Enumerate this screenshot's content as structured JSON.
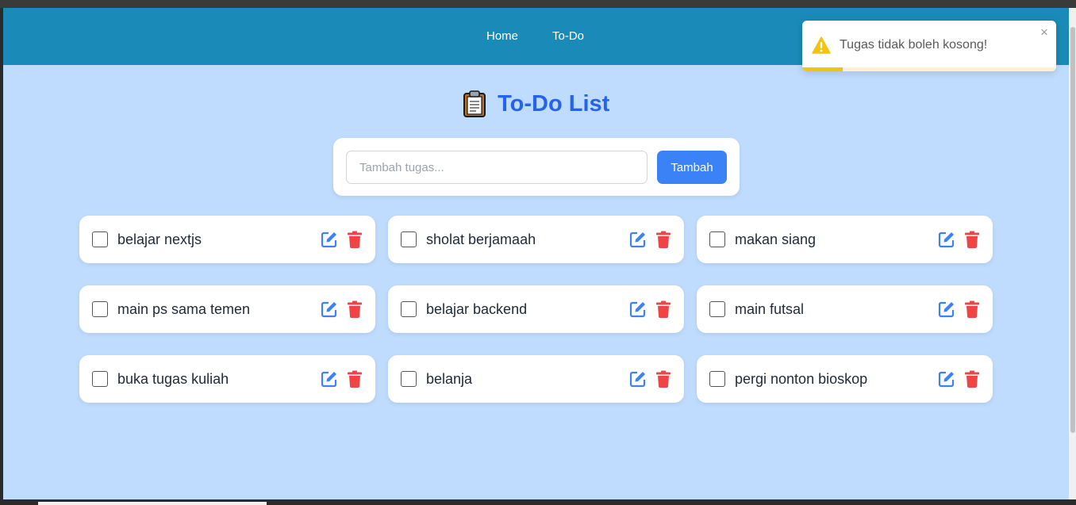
{
  "nav": {
    "home": "Home",
    "todo": "To-Do"
  },
  "page": {
    "title_icon": "clipboard-icon",
    "title": "To-Do List"
  },
  "input": {
    "placeholder": "Tambah tugas...",
    "value": "",
    "button_label": "Tambah"
  },
  "todos": [
    {
      "text": "belajar nextjs",
      "done": false
    },
    {
      "text": "sholat berjamaah",
      "done": false
    },
    {
      "text": "makan siang",
      "done": false
    },
    {
      "text": "main ps sama temen",
      "done": false
    },
    {
      "text": "belajar backend",
      "done": false
    },
    {
      "text": "main futsal",
      "done": false
    },
    {
      "text": "buka tugas kuliah",
      "done": false
    },
    {
      "text": "belanja",
      "done": false
    },
    {
      "text": "pergi nonton bioskop",
      "done": false
    }
  ],
  "toast": {
    "icon": "warning-icon",
    "message": "Tugas tidak boleh kosong!",
    "close": "×",
    "progress": 0.16
  },
  "colors": {
    "navbar": "#1a8bb8",
    "background": "#bfdbfe",
    "accent": "#2563eb",
    "button": "#3b82f6",
    "edit": "#3b82f6",
    "delete": "#ef4444",
    "warning": "#f1c40f"
  }
}
